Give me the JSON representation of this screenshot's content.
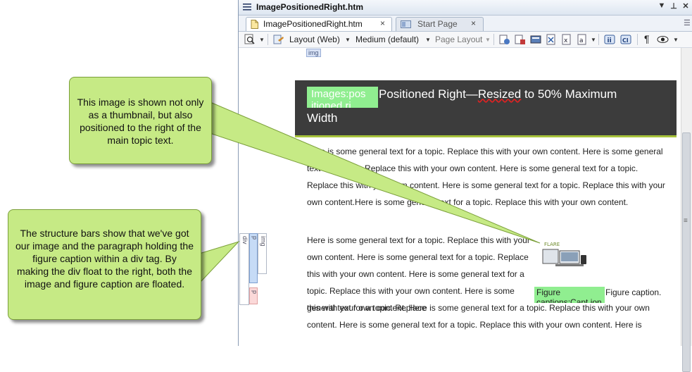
{
  "window": {
    "title": "ImagePositionedRight.htm",
    "btn_dropdown": "▼",
    "btn_pin": "⊥",
    "btn_close": "✕"
  },
  "tabs": [
    {
      "label": "ImagePositionedRight.htm",
      "close": "×",
      "active": true
    },
    {
      "label": "Start Page",
      "close": "×",
      "active": false
    }
  ],
  "toolbar": {
    "layout_label": "Layout (Web)",
    "medium_label": "Medium (default)",
    "page_layout_label": "Page Layout",
    "pilcrow": "¶",
    "dropdown_arrow": "▼"
  },
  "editor": {
    "img_tag": "img",
    "heading_class_label": "Images:pos itioned ri",
    "heading_line1_pre": "Positioned Right—",
    "heading_line1_misspelled": "Resized",
    "heading_line1_post": " to 50% Maximum",
    "heading_line2": "Width",
    "para1": "Here is some general text for a topic. Replace this with your own content. Here is some general text for a topic. Replace this with your own content. Here is some general text for a topic. Replace this with your own content. Here is some general text for a topic. Replace this with your own content.Here is some general text for a topic. Replace this with your own content.",
    "para2": "Here is some general text for a topic. Replace this with your own content. Here is some general text for a topic. Replace this with your own content. Here is some general text for a topic. Replace this with your own content. Here is some general text for a topic. Replace",
    "para3": "this with your own content. Here is some general text for a topic. Replace this with your own content. Here is some general text for a topic. Replace this with your own content. Here is",
    "figure_image_text": "FLARE",
    "figure_class_label": "Figure captions:Capt ion",
    "figure_caption": "Figure caption."
  },
  "structure_bars": {
    "div": "div",
    "p": "p",
    "img": "img",
    "p_bottom": "p"
  },
  "callouts": {
    "top": "This image is shown not only as a thumbnail, but also positioned to the right of the main topic text.",
    "bottom": "The structure bars show that we've got our image and the paragraph holding the figure caption within a div tag. By making the div float to the right, both the image and figure caption are floated."
  },
  "colors": {
    "heading_bg": "#3c3c3c",
    "class_highlight": "#90ee90",
    "callout_fill": "#c6ea85",
    "heading_underline": "#a7c23b"
  }
}
